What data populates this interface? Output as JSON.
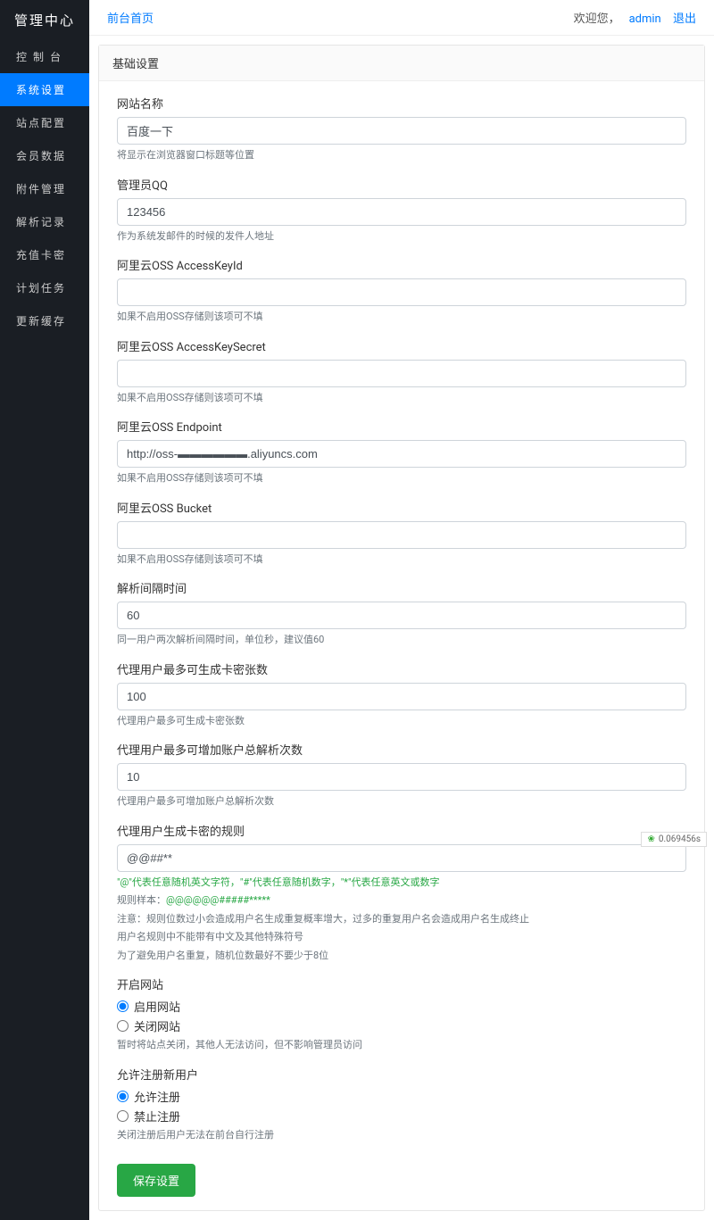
{
  "sidebar": {
    "title": "管理中心",
    "items": [
      {
        "label": "控 制 台"
      },
      {
        "label": "系统设置"
      },
      {
        "label": "站点配置"
      },
      {
        "label": "会员数据"
      },
      {
        "label": "附件管理"
      },
      {
        "label": "解析记录"
      },
      {
        "label": "充值卡密"
      },
      {
        "label": "计划任务"
      },
      {
        "label": "更新缓存"
      }
    ]
  },
  "topbar": {
    "home_link": "前台首页",
    "welcome": "欢迎您，",
    "username": "admin",
    "logout": "退出"
  },
  "panel_title": "基础设置",
  "fields": {
    "site_name": {
      "label": "网站名称",
      "value": "百度一下",
      "help": "将显示在浏览器窗口标题等位置"
    },
    "admin_qq": {
      "label": "管理员QQ",
      "value": "123456",
      "help": "作为系统发邮件的时候的发件人地址"
    },
    "oss_key": {
      "label": "阿里云OSS AccessKeyId",
      "value": "",
      "help": "如果不启用OSS存储则该项可不填"
    },
    "oss_secret": {
      "label": "阿里云OSS AccessKeySecret",
      "value": "",
      "help": "如果不启用OSS存储则该项可不填"
    },
    "oss_endpoint": {
      "label": "阿里云OSS Endpoint",
      "value": "http://oss-▬▬▬▬▬▬.aliyuncs.com",
      "help": "如果不启用OSS存储则该项可不填"
    },
    "oss_bucket": {
      "label": "阿里云OSS Bucket",
      "value": "",
      "help": "如果不启用OSS存储则该项可不填"
    },
    "parse_interval": {
      "label": "解析间隔时间",
      "value": "60",
      "help": "同一用户两次解析间隔时间，单位秒，建议值60"
    },
    "max_cards": {
      "label": "代理用户最多可生成卡密张数",
      "value": "100",
      "help": "代理用户最多可生成卡密张数"
    },
    "max_parse": {
      "label": "代理用户最多可增加账户总解析次数",
      "value": "10",
      "help": "代理用户最多可增加账户总解析次数"
    },
    "card_rule": {
      "label": "代理用户生成卡密的规则",
      "value": "@@##**",
      "help1": "\"@\"代表任意随机英文字符，\"#\"代表任意随机数字，\"*\"代表任意英文或数字",
      "help2_prefix": "规则样本：",
      "help2_sample": "@@@@@@#####*****",
      "help3": "注意：规则位数过小会造成用户名生成重复概率增大，过多的重复用户名会造成用户名生成终止",
      "help4": "用户名规则中不能带有中文及其他特殊符号",
      "help5": "为了避免用户名重复，随机位数最好不要少于8位"
    },
    "site_open": {
      "label": "开启网站",
      "opt1": "启用网站",
      "opt2": "关闭网站",
      "help": "暂时将站点关闭，其他人无法访问，但不影响管理员访问"
    },
    "allow_reg": {
      "label": "允许注册新用户",
      "opt1": "允许注册",
      "opt2": "禁止注册",
      "help": "关闭注册后用户无法在前台自行注册"
    }
  },
  "save_label": "保存设置",
  "footer_time": "0.069456s"
}
